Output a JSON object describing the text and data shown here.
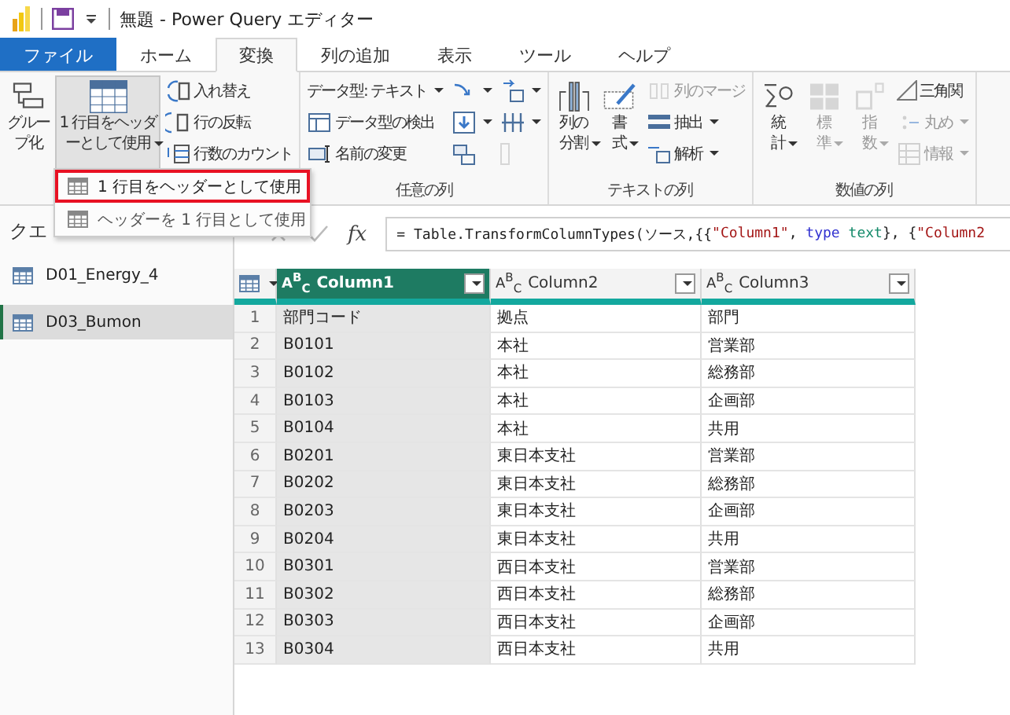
{
  "title_bar": {
    "title": "無題 - Power Query エディター"
  },
  "tabs": [
    {
      "label": "ファイル",
      "kind": "file",
      "selected": false
    },
    {
      "label": "ホーム",
      "kind": "tab",
      "selected": false
    },
    {
      "label": "変換",
      "kind": "tab",
      "selected": true
    },
    {
      "label": "列の追加",
      "kind": "tab",
      "selected": false
    },
    {
      "label": "表示",
      "kind": "tab",
      "selected": false
    },
    {
      "label": "ツール",
      "kind": "tab",
      "selected": false
    },
    {
      "label": "ヘルプ",
      "kind": "tab",
      "selected": false
    }
  ],
  "ribbon": {
    "groups": [
      {
        "columns": [
          [
            {
              "kind": "large",
              "label": "グループ化",
              "dropdown": false,
              "disabled": false,
              "expanded": false
            }
          ],
          [
            {
              "kind": "large",
              "label": "1 行目をヘッダーとして使用",
              "dropdown": true,
              "disabled": false,
              "expanded": true
            }
          ],
          [
            {
              "kind": "small",
              "label": "入れ替え",
              "dropdown": false,
              "disabled": false,
              "expanded": false
            },
            {
              "kind": "small",
              "label": "行の反転",
              "dropdown": false,
              "disabled": false,
              "expanded": false
            },
            {
              "kind": "small",
              "label": "行数のカウント",
              "dropdown": false,
              "disabled": false,
              "expanded": false
            }
          ]
        ]
      },
      {
        "label": "任意の列",
        "columns": [
          [
            {
              "kind": "small",
              "label": "データ型: テキスト",
              "dropdown": true,
              "disabled": false,
              "expanded": false
            },
            {
              "kind": "small",
              "label": "データ型の検出",
              "dropdown": false,
              "disabled": false,
              "expanded": false
            },
            {
              "kind": "small",
              "label": "名前の変更",
              "dropdown": false,
              "disabled": false,
              "expanded": false
            }
          ],
          [
            {
              "kind": "icon",
              "dropdown": true,
              "disabled": false,
              "expanded": false
            },
            {
              "kind": "icon",
              "dropdown": true,
              "disabled": false,
              "expanded": false
            },
            {
              "kind": "icon",
              "dropdown": false,
              "disabled": false,
              "expanded": false
            }
          ],
          [
            {
              "kind": "icon",
              "dropdown": true,
              "disabled": false,
              "expanded": false
            },
            {
              "kind": "icon",
              "dropdown": true,
              "disabled": false,
              "expanded": false
            },
            {
              "kind": "icon",
              "dropdown": false,
              "disabled": true,
              "expanded": false
            }
          ]
        ]
      },
      {
        "label": "テキストの列",
        "columns": [
          [
            {
              "kind": "large",
              "label": "列の分割",
              "dropdown": true,
              "disabled": false,
              "expanded": false
            }
          ],
          [
            {
              "kind": "large",
              "label": "書式",
              "dropdown": true,
              "disabled": false,
              "expanded": false
            }
          ],
          [
            {
              "kind": "small",
              "label": "列のマージ",
              "dropdown": false,
              "disabled": true,
              "expanded": false
            },
            {
              "kind": "small",
              "label": "抽出",
              "dropdown": true,
              "disabled": false,
              "expanded": false
            },
            {
              "kind": "small",
              "label": "解析",
              "dropdown": true,
              "disabled": false,
              "expanded": false
            }
          ]
        ]
      },
      {
        "label": "数値の列",
        "columns": [
          [
            {
              "kind": "large",
              "label": "統計",
              "dropdown": true,
              "disabled": false,
              "expanded": false
            }
          ],
          [
            {
              "kind": "large",
              "label": "標準",
              "dropdown": true,
              "disabled": true,
              "expanded": false
            }
          ],
          [
            {
              "kind": "large",
              "label": "指数",
              "dropdown": true,
              "disabled": true,
              "expanded": false
            }
          ],
          [
            {
              "kind": "small",
              "label": "三角関",
              "dropdown": false,
              "disabled": false,
              "expanded": false
            },
            {
              "kind": "small",
              "label": "丸め",
              "dropdown": true,
              "disabled": true,
              "expanded": false
            },
            {
              "kind": "small",
              "label": "情報",
              "dropdown": true,
              "disabled": true,
              "expanded": false
            }
          ]
        ]
      }
    ]
  },
  "menu": {
    "items": [
      {
        "label": "1 行目をヘッダーとして使用",
        "selected": true
      },
      {
        "label": "ヘッダーを 1 行目として使用",
        "selected": false
      }
    ]
  },
  "queries": {
    "header": "クエ",
    "items": [
      {
        "name": "D01_Energy_4",
        "selected": false
      },
      {
        "name": "D03_Bumon",
        "selected": true
      }
    ]
  },
  "formula": {
    "fx": "fx",
    "tokens": [
      {
        "text": "= Table.TransformColumnTypes(ソース,{{",
        "kind": "plain"
      },
      {
        "text": "\"Column1\"",
        "kind": "string"
      },
      {
        "text": ", ",
        "kind": "plain"
      },
      {
        "text": "type",
        "kind": "keyword"
      },
      {
        "text": " text",
        "kind": "typename"
      },
      {
        "text": "}, {",
        "kind": "plain"
      },
      {
        "text": "\"Column2",
        "kind": "string"
      }
    ]
  },
  "table": {
    "columns": [
      {
        "type": "A$^{B}$$_{C}$",
        "name": "Column1",
        "selected": true
      },
      {
        "type": "A$^{B}$$_{C}$",
        "name": "Column2",
        "selected": false
      },
      {
        "type": "A$^{B}$$_{C}$",
        "name": "Column3",
        "selected": false
      }
    ],
    "rows": [
      {
        "number": "1",
        "cells": [
          "部門コード",
          "拠点",
          "部門"
        ]
      },
      {
        "number": "2",
        "cells": [
          "B0101",
          "本社",
          "営業部"
        ]
      },
      {
        "number": "3",
        "cells": [
          "B0102",
          "本社",
          "総務部"
        ]
      },
      {
        "number": "4",
        "cells": [
          "B0103",
          "本社",
          "企画部"
        ]
      },
      {
        "number": "5",
        "cells": [
          "B0104",
          "本社",
          "共用"
        ]
      },
      {
        "number": "6",
        "cells": [
          "B0201",
          "東日本支社",
          "営業部"
        ]
      },
      {
        "number": "7",
        "cells": [
          "B0202",
          "東日本支社",
          "総務部"
        ]
      },
      {
        "number": "8",
        "cells": [
          "B0203",
          "東日本支社",
          "企画部"
        ]
      },
      {
        "number": "9",
        "cells": [
          "B0204",
          "東日本支社",
          "共用"
        ]
      },
      {
        "number": "10",
        "cells": [
          "B0301",
          "西日本支社",
          "営業部"
        ]
      },
      {
        "number": "11",
        "cells": [
          "B0302",
          "西日本支社",
          "総務部"
        ]
      },
      {
        "number": "12",
        "cells": [
          "B0303",
          "西日本支社",
          "企画部"
        ]
      },
      {
        "number": "13",
        "cells": [
          "B0304",
          "西日本支社",
          "共用"
        ]
      }
    ]
  }
}
